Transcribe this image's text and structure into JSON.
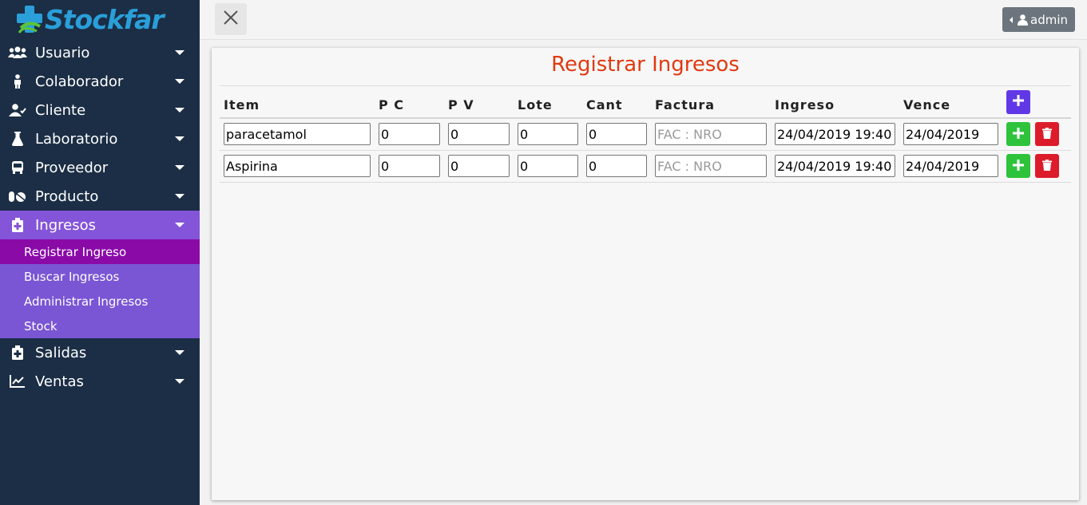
{
  "app": {
    "brand": "Stockfar"
  },
  "sidebar": {
    "items": [
      {
        "label": "Usuario",
        "icon": "users-icon"
      },
      {
        "label": "Colaborador",
        "icon": "collaborator-icon"
      },
      {
        "label": "Cliente",
        "icon": "client-icon"
      },
      {
        "label": "Laboratorio",
        "icon": "flask-icon"
      },
      {
        "label": "Proveedor",
        "icon": "bus-icon"
      },
      {
        "label": "Producto",
        "icon": "pills-icon"
      },
      {
        "label": "Ingresos",
        "icon": "medkit-icon",
        "active": true
      },
      {
        "label": "Salidas",
        "icon": "medkit-icon"
      },
      {
        "label": "Ventas",
        "icon": "chart-line-icon"
      }
    ],
    "submenu": [
      {
        "label": "Registrar Ingreso",
        "selected": true
      },
      {
        "label": "Buscar Ingresos"
      },
      {
        "label": "Administrar Ingresos"
      },
      {
        "label": "Stock"
      }
    ]
  },
  "topbar": {
    "user_label": "admin"
  },
  "main": {
    "title": "Registrar Ingresos",
    "columns": [
      "Item",
      "P C",
      "P V",
      "Lote",
      "Cant",
      "Factura",
      "Ingreso",
      "Vence"
    ],
    "factura_placeholder": "FAC : NRO",
    "rows": [
      {
        "item": "paracetamol",
        "pc": "0",
        "pv": "0",
        "lote": "0",
        "cant": "0",
        "factura": "",
        "ingreso": "24/04/2019 19:40",
        "vence": "24/04/2019"
      },
      {
        "item": "Aspirina",
        "pc": "0",
        "pv": "0",
        "lote": "0",
        "cant": "0",
        "factura": "",
        "ingreso": "24/04/2019 19:40",
        "vence": "24/04/2019"
      }
    ]
  },
  "colors": {
    "sidebar_bg": "#1b2e45",
    "submenu_bg": "#7a55d4",
    "submenu_selected": "#8a0aa8",
    "title": "#e03a12",
    "btn_add_header": "#6138e6",
    "btn_add_row": "#2ec33b",
    "btn_delete": "#dc1c2a"
  }
}
